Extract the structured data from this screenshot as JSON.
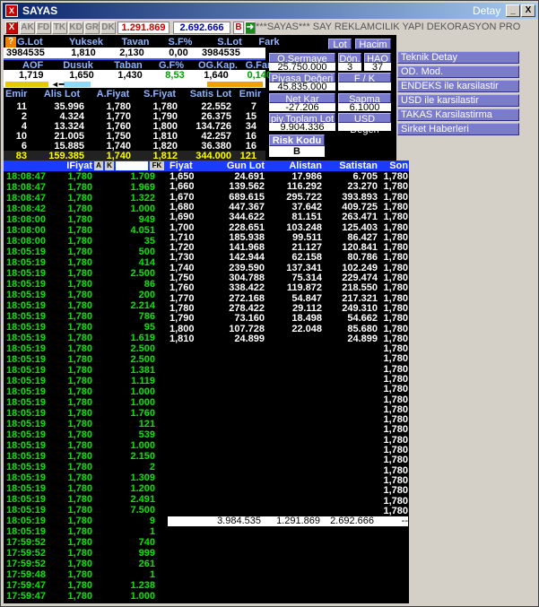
{
  "window": {
    "title": "SAYAS",
    "detay_label": "Detay",
    "min_glyph": "_",
    "max_glyph": "□",
    "close_glyph": "X",
    "icon_glyph": "X"
  },
  "toolbar": {
    "close_glyph": "X",
    "tabs": [
      "AK",
      "FD",
      "TK",
      "KD",
      "GR",
      "DK"
    ],
    "price_red": "1.291.869",
    "price_blue": "2.692.666",
    "b_label": "B",
    "marquee": "***SAYAS*** SAY REKLAMCILIK YAPI DEKORASYON PRO"
  },
  "summary": {
    "q_label": "?",
    "headers1": [
      "G.Lot",
      "Yuksek",
      "Tavan",
      "S.F%",
      "S.Lot",
      "Fark"
    ],
    "values1": [
      "3984535",
      "1,810",
      "2,130",
      "0,00",
      "3984535",
      ""
    ],
    "headers2": [
      "AOF",
      "Dusuk",
      "Taban",
      "G.F%",
      "OG.Kap.",
      "G.Fark"
    ],
    "values2": [
      "1,719",
      "1,650",
      "1,430",
      "8,53",
      "1,640",
      "0,140"
    ]
  },
  "order_book": {
    "headers": [
      "Emir",
      "Alis Lot",
      "A.Fiyat",
      "S.Fiyat",
      "Satis Lot",
      "Emir"
    ],
    "rows": [
      [
        "11",
        "35.996",
        "1,780",
        "1,780",
        "22.552",
        "7"
      ],
      [
        "2",
        "4.324",
        "1,770",
        "1,790",
        "26.375",
        "15"
      ],
      [
        "4",
        "13.324",
        "1,760",
        "1,800",
        "134.726",
        "34"
      ],
      [
        "10",
        "21.005",
        "1,750",
        "1,810",
        "42.257",
        "16"
      ],
      [
        "6",
        "15.885",
        "1,740",
        "1,820",
        "36.380",
        "16"
      ]
    ],
    "total": [
      "83",
      "159.385",
      "1,740",
      "1,812",
      "344.000",
      "121"
    ]
  },
  "info_panel": {
    "lot_btn": "Lot",
    "hacim_btn": "Hacim",
    "osermaye_label": "O.Sermaye",
    "osermaye_value": "25.750.000",
    "don_label": "Dön.",
    "don_value": "3",
    "hao_label": "HAO",
    "hao_value": "37",
    "piyasa_label": "Piyasa Değeri",
    "piyasa_value": "45.835.000",
    "fk_label": "F / K",
    "fk_value": "",
    "netkar_label": "Net Kar",
    "netkar_value": "-27.206",
    "sapma_label": "Sapma",
    "sapma_value": "6.1000",
    "piytoplam_label": "piy.Toplam Lot",
    "piytoplam_value": "9.904.336",
    "usd_label": "USD Değeri",
    "usd_value": "",
    "risk_label": "Risk Kodu",
    "risk_value": "B"
  },
  "right_menu": [
    "Teknik Detay",
    "OD. Mod.",
    "ENDEKS ile karsilastir",
    "USD ile karsilastir",
    "TAKAS Karsilastirma",
    "Sirket Haberleri"
  ],
  "trades": {
    "header_fiyat": "IFiyat",
    "btn_a": "A",
    "btn_k": "K",
    "btn_fk": "FK",
    "rows": [
      [
        "18:08:47",
        "1,780",
        "1.709"
      ],
      [
        "18:08:47",
        "1,780",
        "1.969"
      ],
      [
        "18:08:47",
        "1,780",
        "1.322"
      ],
      [
        "18:08:42",
        "1,780",
        "1.000"
      ],
      [
        "18:08:00",
        "1,780",
        "949"
      ],
      [
        "18:08:00",
        "1,780",
        "4.051"
      ],
      [
        "18:08:00",
        "1,780",
        "35"
      ],
      [
        "18:05:19",
        "1,780",
        "500"
      ],
      [
        "18:05:19",
        "1,780",
        "414"
      ],
      [
        "18:05:19",
        "1,780",
        "2.500"
      ],
      [
        "18:05:19",
        "1,780",
        "86"
      ],
      [
        "18:05:19",
        "1,780",
        "200"
      ],
      [
        "18:05:19",
        "1,780",
        "2.214"
      ],
      [
        "18:05:19",
        "1,780",
        "786"
      ],
      [
        "18:05:19",
        "1,780",
        "95"
      ],
      [
        "18:05:19",
        "1,780",
        "1.619"
      ],
      [
        "18:05:19",
        "1,780",
        "2.500"
      ],
      [
        "18:05:19",
        "1,780",
        "2.500"
      ],
      [
        "18:05:19",
        "1,780",
        "1.381"
      ],
      [
        "18:05:19",
        "1,780",
        "1.119"
      ],
      [
        "18:05:19",
        "1,780",
        "1.000"
      ],
      [
        "18:05:19",
        "1,780",
        "1.000"
      ],
      [
        "18:05:19",
        "1,780",
        "1.760"
      ],
      [
        "18:05:19",
        "1,780",
        "121"
      ],
      [
        "18:05:19",
        "1,780",
        "539"
      ],
      [
        "18:05:19",
        "1,780",
        "1.000"
      ],
      [
        "18:05:19",
        "1,780",
        "2.150"
      ],
      [
        "18:05:19",
        "1,780",
        "2"
      ],
      [
        "18:05:19",
        "1,780",
        "1.309"
      ],
      [
        "18:05:19",
        "1,780",
        "1.200"
      ],
      [
        "18:05:19",
        "1,780",
        "2.491"
      ],
      [
        "18:05:19",
        "1,780",
        "7.500"
      ],
      [
        "18:05:19",
        "1,780",
        "9"
      ],
      [
        "18:05:19",
        "1,780",
        "1"
      ],
      [
        "17:59:52",
        "1,780",
        "740"
      ],
      [
        "17:59:52",
        "1,780",
        "999"
      ],
      [
        "17:59:52",
        "1,780",
        "261"
      ],
      [
        "17:59:48",
        "1,780",
        "1"
      ],
      [
        "17:59:47",
        "1,780",
        "1.238"
      ],
      [
        "17:59:47",
        "1,780",
        "1.000"
      ]
    ]
  },
  "price_dist": {
    "headers": [
      "Fiyat",
      "Gun Lot",
      "Alistan",
      "Satistan",
      "Son"
    ],
    "rows": [
      [
        "1,650",
        "24.691",
        "17.986",
        "6.705",
        "1,780"
      ],
      [
        "1,660",
        "139.562",
        "116.292",
        "23.270",
        "1,780"
      ],
      [
        "1,670",
        "689.615",
        "295.722",
        "393.893",
        "1,780"
      ],
      [
        "1,680",
        "447.367",
        "37.642",
        "409.725",
        "1,780"
      ],
      [
        "1,690",
        "344.622",
        "81.151",
        "263.471",
        "1,780"
      ],
      [
        "1,700",
        "228.651",
        "103.248",
        "125.403",
        "1,780"
      ],
      [
        "1,710",
        "185.938",
        "99.511",
        "86.427",
        "1,780"
      ],
      [
        "1,720",
        "141.968",
        "21.127",
        "120.841",
        "1,780"
      ],
      [
        "1,730",
        "142.944",
        "62.158",
        "80.786",
        "1,780"
      ],
      [
        "1,740",
        "239.590",
        "137.341",
        "102.249",
        "1,780"
      ],
      [
        "1,750",
        "304.788",
        "75.314",
        "229.474",
        "1,780"
      ],
      [
        "1,760",
        "338.422",
        "119.872",
        "218.550",
        "1,780"
      ],
      [
        "1,770",
        "272.168",
        "54.847",
        "217.321",
        "1,780"
      ],
      [
        "1,780",
        "278.422",
        "29.112",
        "249.310",
        "1,780"
      ],
      [
        "1,790",
        "73.160",
        "18.498",
        "54.662",
        "1,780"
      ],
      [
        "1,800",
        "107.728",
        "22.048",
        "85.680",
        "1,780"
      ],
      [
        "1,810",
        "24.899",
        "",
        "24.899",
        "1,780"
      ]
    ],
    "extra_son": [
      "1,780",
      "1,780",
      "1,780",
      "1,780",
      "1,780",
      "1,780",
      "1,780",
      "1,780",
      "1,780",
      "1,780",
      "1,780",
      "1,780",
      "1,780",
      "1,780",
      "1,780",
      "1,780",
      "1,780"
    ],
    "totals": [
      "3.984.535",
      "1.291.869",
      "2.692.666",
      "--"
    ]
  }
}
